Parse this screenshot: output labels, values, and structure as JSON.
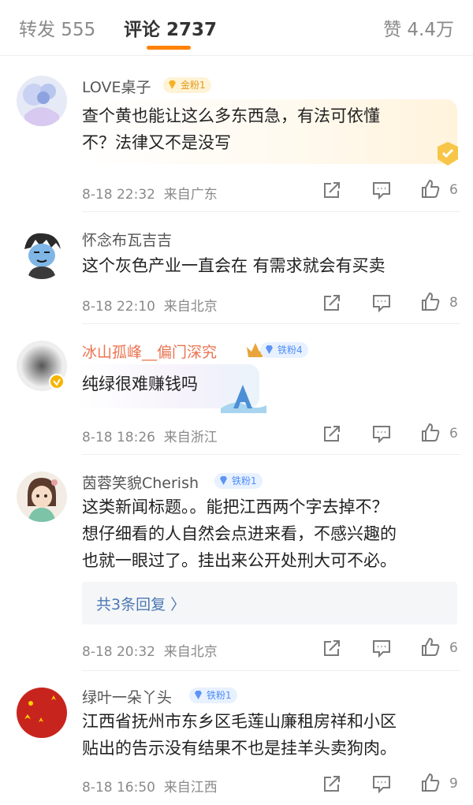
{
  "tabs": {
    "repost": "转发 555",
    "comments": "评论 2737",
    "likes": "赞 4.4万"
  },
  "colors": {
    "accent": "#ff8200",
    "link": "#4a78b4",
    "highlight_name": "#eb7350"
  },
  "comments": [
    {
      "user": "LOVE桌子",
      "badge": "金粉1",
      "badge_type": "gold",
      "lines": [
        "查个黄也能让这么多东西急，有法可依懂",
        "不？法律又不是没写"
      ],
      "time": "8-18 22:32",
      "location": "来自广东",
      "likes": "6"
    },
    {
      "user": "怀念布瓦吉吉",
      "lines": [
        "这个灰色产业一直会在 有需求就会有买卖"
      ],
      "time": "8-18 22:10",
      "location": "来自北京",
      "likes": "8"
    },
    {
      "user": "冰山孤峰__偏门深究",
      "badge": "铁粉4",
      "badge_type": "iron",
      "lines": [
        "纯绿很难赚钱吗"
      ],
      "time": "8-18 18:26",
      "location": "来自浙江",
      "likes": "6"
    },
    {
      "user": "茵蓉笑貌Cherish",
      "badge": "铁粉1",
      "badge_type": "iron",
      "lines": [
        "这类新闻标题。。能把江西两个字去掉不？",
        "想仔细看的人自然会点进来看，不感兴趣的",
        "也就一眼过了。挂出来公开处刑大可不必。"
      ],
      "replies": "共3条回复 〉",
      "time": "8-18 20:32",
      "location": "来自北京",
      "likes": "6"
    },
    {
      "user": "绿叶一朵丫头",
      "badge": "铁粉1",
      "badge_type": "iron",
      "lines": [
        "江西省抚州市东乡区毛莲山廉租房祥和小区",
        "贴出的告示没有结果不也是挂羊头卖狗肉。"
      ],
      "time": "8-18 16:50",
      "location": "来自江西",
      "likes": "9"
    }
  ]
}
